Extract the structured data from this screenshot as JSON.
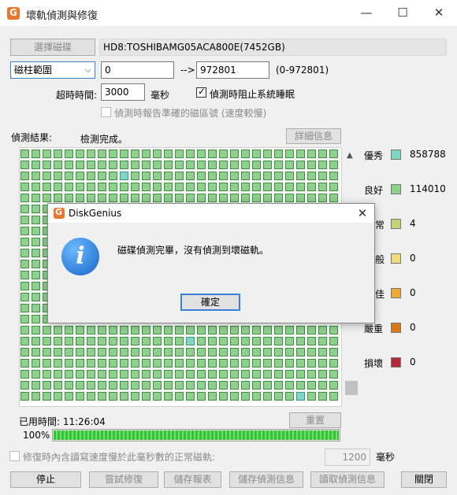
{
  "window": {
    "title": "壞軌偵測與修復",
    "minimize": "—",
    "maximize": "☐",
    "close": "✕"
  },
  "toolbar": {
    "select_disk_button": "選擇磁碟",
    "disk_name": "HD8:TOSHIBAMG05ACA800E(7452GB)"
  },
  "range": {
    "mode": "磁柱範圍",
    "start": "0",
    "arrow": "-->",
    "end": "972801",
    "hint": "(0-972801)"
  },
  "timeout": {
    "label": "超時時間:",
    "value": "3000",
    "unit": "毫秒",
    "prevent_sleep_label": "偵測時阻止系統睡眠",
    "prevent_sleep_checked": true,
    "report_sector_label": "偵測時報告準確的磁區號 (速度較慢)",
    "report_sector_checked": false
  },
  "results": {
    "label": "偵測結果:",
    "status": "檢測完成。",
    "details_button": "詳細信息"
  },
  "legend": [
    {
      "label": "優秀",
      "value": "858788",
      "color": "#7dd8c1"
    },
    {
      "label": "良好",
      "value": "114010",
      "color": "#8cd08c"
    },
    {
      "label": "常",
      "value": "4",
      "color": "#c7d37a"
    },
    {
      "label": "般",
      "value": "0",
      "color": "#f0dc7a"
    },
    {
      "label": "佳",
      "value": "0",
      "color": "#eeaa33"
    },
    {
      "label": "嚴重",
      "value": "0",
      "color": "#d97a1a"
    },
    {
      "label": "損壞",
      "value": "0",
      "color": "#b52a3a"
    }
  ],
  "elapsed": {
    "label": "已用時間: 11:26:04",
    "reset_button": "重置"
  },
  "progress": {
    "percent_label": "100%",
    "value": 1.0
  },
  "repair": {
    "option_label": "修復時內含讀寫速度慢於此毫秒數的正常磁軌:",
    "option_checked": false,
    "threshold": "1200",
    "unit": "毫秒"
  },
  "buttons": {
    "stop": "停止",
    "try_repair": "嘗試修復",
    "save_report": "儲存報表",
    "save_scan": "儲存偵測信息",
    "load_scan": "讀取偵測信息",
    "close": "關閉"
  },
  "dialog": {
    "title": "DiskGenius",
    "message": "磁碟偵測完畢，沒有偵測到壞磁軌。",
    "ok": "確定",
    "close": "✕",
    "icon": "i"
  },
  "scroll_up": "▲"
}
